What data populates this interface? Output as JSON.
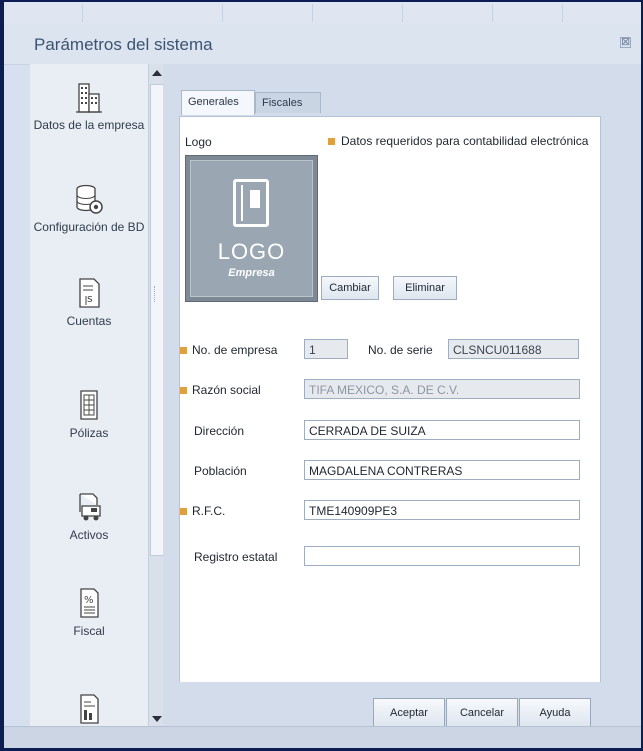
{
  "window": {
    "title": "Parámetros del sistema",
    "close_glyph": "⊠"
  },
  "sidebar": {
    "items": [
      {
        "label": "Datos de la empresa",
        "icon": "building-icon"
      },
      {
        "label": "Configuración de BD",
        "icon": "database-gear-icon"
      },
      {
        "label": "Cuentas",
        "icon": "document-ledger-icon"
      },
      {
        "label": "Pólizas",
        "icon": "document-list-icon"
      },
      {
        "label": "Activos",
        "icon": "truck-icon"
      },
      {
        "label": "Fiscal",
        "icon": "percent-document-icon"
      },
      {
        "label": "",
        "icon": "report-icon"
      }
    ]
  },
  "tabs": [
    {
      "label": "Generales",
      "active": true
    },
    {
      "label": "Fiscales",
      "active": false
    }
  ],
  "form": {
    "logo_label": "Logo",
    "required_note": "Datos requeridos para contabilidad electrónica",
    "logo_text": "LOGO",
    "logo_subtext": "Empresa",
    "change_button": "Cambiar",
    "delete_button": "Eliminar",
    "company_no_label": "No. de empresa",
    "company_no_value": "1",
    "serial_label": "No. de serie",
    "serial_value": "CLSNCU011688",
    "business_name_label": "Razón social",
    "business_name_value": "TIFA MEXICO, S.A. DE C.V.",
    "address_label": "Dirección",
    "address_value": "CERRADA DE SUIZA",
    "city_label": "Población",
    "city_value": "MAGDALENA CONTRERAS",
    "rfc_label": "R.F.C.",
    "rfc_value": "TME140909PE3",
    "state_reg_label": "Registro estatal",
    "state_reg_value": ""
  },
  "footer": {
    "accept": "Aceptar",
    "cancel": "Cancelar",
    "help": "Ayuda"
  },
  "colors": {
    "required_marker": "#e0a040",
    "window_bg": "#d7e0ee",
    "frame": "#0b1d52"
  }
}
